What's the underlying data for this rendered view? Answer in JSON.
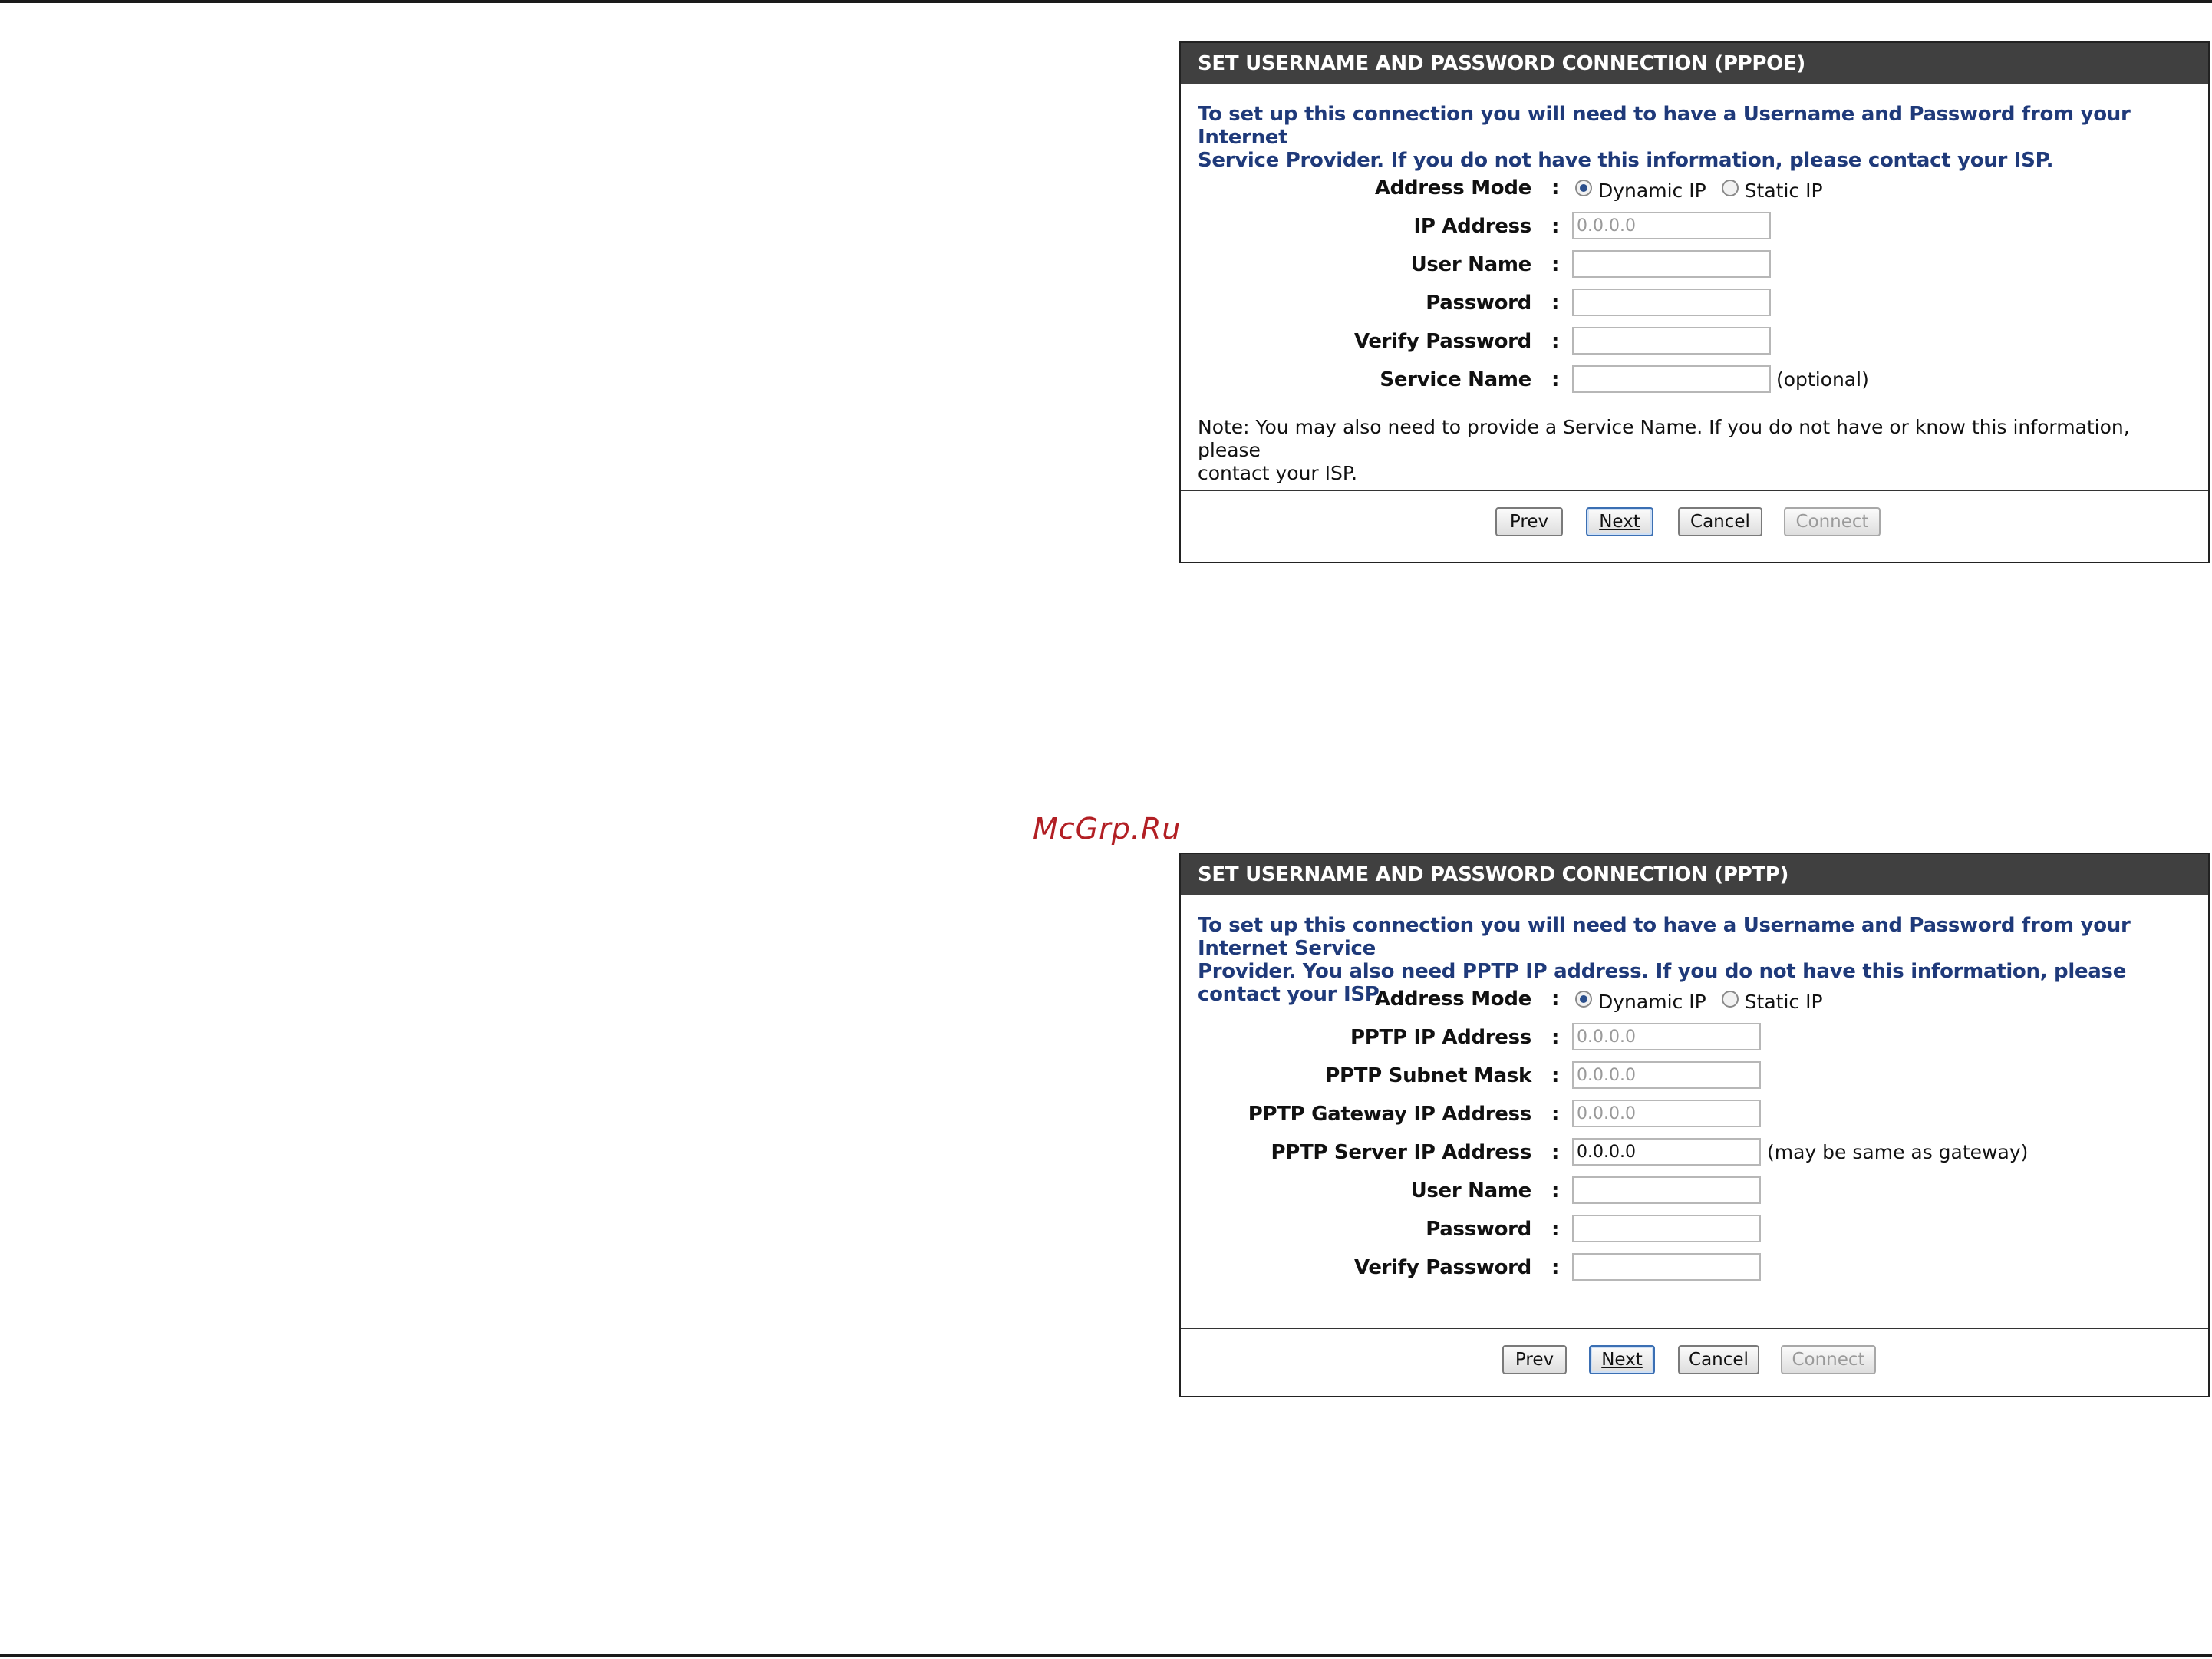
{
  "watermark": "McGrp.Ru",
  "pppoe": {
    "title": "SET USERNAME AND PASSWORD CONNECTION (PPPOE)",
    "intro_line1": "To set up this connection you will need to have a Username and Password from your Internet",
    "intro_line2": "Service Provider. If you do not have this information, please contact your ISP.",
    "address_mode_label": "Address Mode",
    "dynamic_ip_label": "Dynamic IP",
    "static_ip_label": "Static IP",
    "selected_mode": "Dynamic IP",
    "ip_address_label": "IP Address",
    "ip_address_value": "0.0.0.0",
    "user_name_label": "User Name",
    "user_name_value": "",
    "password_label": "Password",
    "password_value": "",
    "verify_password_label": "Verify Password",
    "verify_password_value": "",
    "service_name_label": "Service Name",
    "service_name_value": "",
    "service_name_hint": "(optional)",
    "note_line1": "Note: You may also need to provide a Service Name. If you do not have or know this information, please",
    "note_line2": "contact your ISP.",
    "buttons": {
      "prev": "Prev",
      "next": "Next",
      "cancel": "Cancel",
      "connect": "Connect"
    }
  },
  "pptp": {
    "title": "SET USERNAME AND PASSWORD CONNECTION (PPTP)",
    "intro_line1": "To set up this connection you will need to have a Username and Password from your Internet Service",
    "intro_line2": "Provider. You also need PPTP IP address. If you do not have this information, please contact your ISP.",
    "address_mode_label": "Address Mode",
    "dynamic_ip_label": "Dynamic IP",
    "static_ip_label": "Static IP",
    "selected_mode": "Dynamic IP",
    "pptp_ip_label": "PPTP IP Address",
    "pptp_ip_value": "0.0.0.0",
    "pptp_subnet_label": "PPTP Subnet Mask",
    "pptp_subnet_value": "0.0.0.0",
    "pptp_gateway_label": "PPTP Gateway IP Address",
    "pptp_gateway_value": "0.0.0.0",
    "pptp_server_label": "PPTP Server IP Address",
    "pptp_server_value": "0.0.0.0",
    "pptp_server_hint": "(may be same as gateway)",
    "user_name_label": "User Name",
    "user_name_value": "",
    "password_label": "Password",
    "password_value": "",
    "verify_password_label": "Verify Password",
    "verify_password_value": "",
    "buttons": {
      "prev": "Prev",
      "next": "Next",
      "cancel": "Cancel",
      "connect": "Connect"
    }
  },
  "colon": ":",
  "colors": {
    "header_bg": "#404040",
    "intro_text": "#1f3a7a",
    "watermark": "#b21f24"
  }
}
